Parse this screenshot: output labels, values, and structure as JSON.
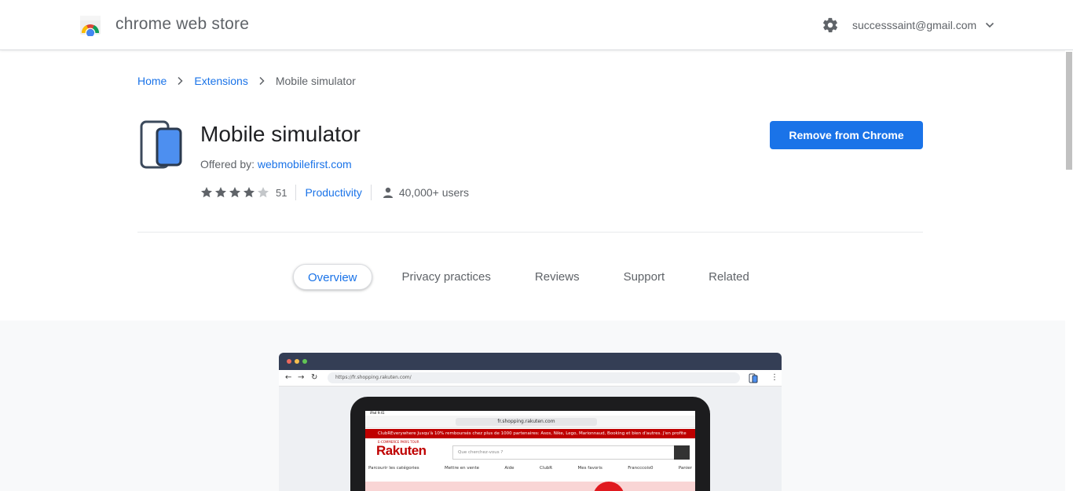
{
  "header": {
    "store_title": "chrome web store",
    "account_email": "successsaint@gmail.com"
  },
  "breadcrumb": {
    "home": "Home",
    "extensions": "Extensions",
    "current": "Mobile simulator"
  },
  "extension": {
    "name": "Mobile simulator",
    "offered_by_label": "Offered by:",
    "offered_by": "webmobilefirst.com",
    "rating": 4,
    "rating_max": 5,
    "rating_count": "51",
    "category": "Productivity",
    "users": "40,000+ users",
    "remove_button": "Remove from Chrome"
  },
  "tabs": [
    {
      "label": "Overview",
      "active": true
    },
    {
      "label": "Privacy practices",
      "active": false
    },
    {
      "label": "Reviews",
      "active": false
    },
    {
      "label": "Support",
      "active": false
    },
    {
      "label": "Related",
      "active": false
    }
  ],
  "screenshot": {
    "browser_url": "https://fr.shopping.rakuten.com/",
    "tablet_status": "iPad 9:41",
    "tablet_url": "fr.shopping.rakuten.com",
    "banner_text": "ClubREverywhere  Jusqu'à 10% remboursés chez plus de 1000 partenaires: Asos, Nike, Lego, Marionnaud, Booking et bien d'autres. J'en profite",
    "logo_tagline": "E-COMMERCE PARIS TOUR",
    "logo": "Rakuten",
    "search_placeholder": "Que cherchez-vous ?",
    "nav_items": [
      "Parcourir les catégories",
      "Mettre en vente",
      "Aide",
      "ClubR",
      "Mes favoris",
      "Francccois0",
      "Panier"
    ]
  },
  "colors": {
    "accent": "#1a73e8",
    "text_secondary": "#5f6368",
    "rakuten_red": "#bf0000"
  }
}
